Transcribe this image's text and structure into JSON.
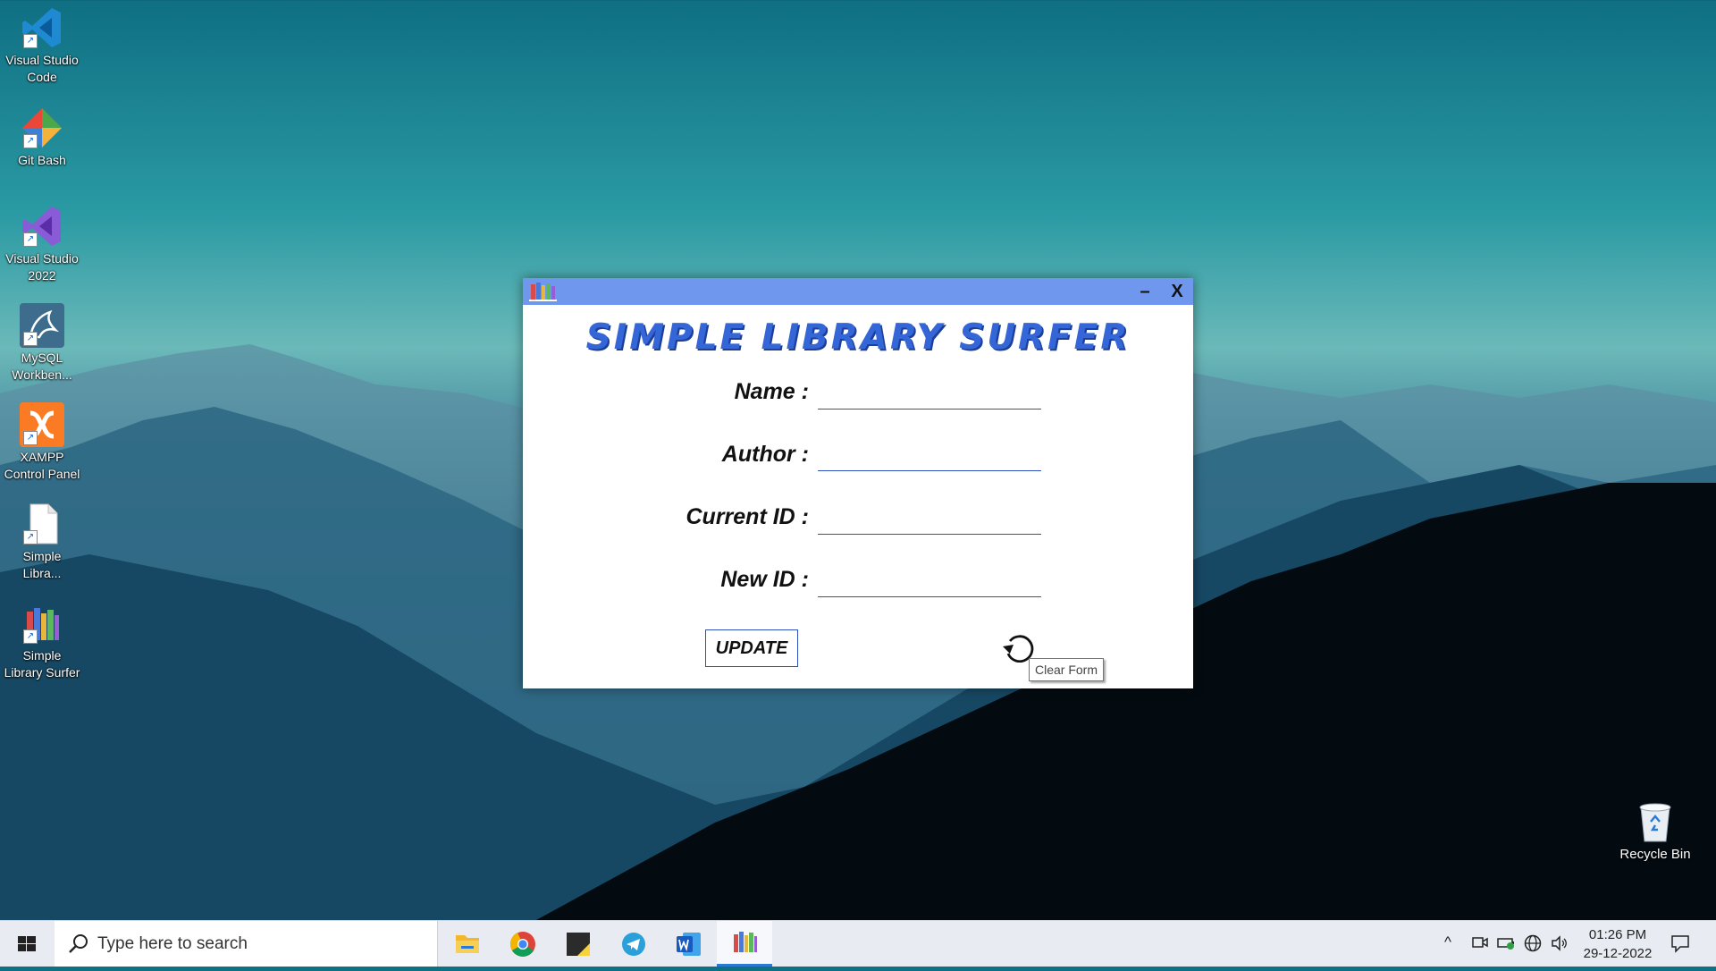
{
  "desktop_icons": [
    {
      "label_line1": "Visual Studio",
      "label_line2": "Code",
      "icon": "vscode-icon"
    },
    {
      "label_line1": "Git Bash",
      "label_line2": "",
      "icon": "git-bash-icon"
    },
    {
      "label_line1": "Visual Studio",
      "label_line2": "2022",
      "icon": "visual-studio-icon"
    },
    {
      "label_line1": "MySQL",
      "label_line2": "Workben...",
      "icon": "mysql-workbench-icon"
    },
    {
      "label_line1": "XAMPP",
      "label_line2": "Control Panel",
      "icon": "xampp-icon"
    },
    {
      "label_line1": "Simple",
      "label_line2": "Libra...",
      "icon": "file-icon"
    },
    {
      "label_line1": "Simple",
      "label_line2": "Library Surfer",
      "icon": "books-icon"
    }
  ],
  "window": {
    "minimize_label": "–",
    "close_label": "X",
    "app_title": "SIMPLE LIBRARY SURFER",
    "fields": [
      {
        "label": "Name :",
        "value": ""
      },
      {
        "label": "Author :",
        "value": ""
      },
      {
        "label": "Current ID :",
        "value": ""
      },
      {
        "label": "New ID :",
        "value": ""
      }
    ],
    "update_label": "UPDATE",
    "tooltip": "Clear Form"
  },
  "recycle_bin": {
    "label": "Recycle Bin"
  },
  "taskbar": {
    "search_placeholder": "Type here to search",
    "apps": [
      "file-explorer-icon",
      "chrome-icon",
      "sticky-notes-icon",
      "telegram-icon",
      "word-icon",
      "books-icon"
    ],
    "time": "01:26 PM",
    "date": "29-12-2022"
  },
  "colors": {
    "titlebar": "#6f97ee",
    "title_text": "#3566d8",
    "input_underline": "#2f4fbf",
    "taskbar": "#e8ecf2"
  }
}
